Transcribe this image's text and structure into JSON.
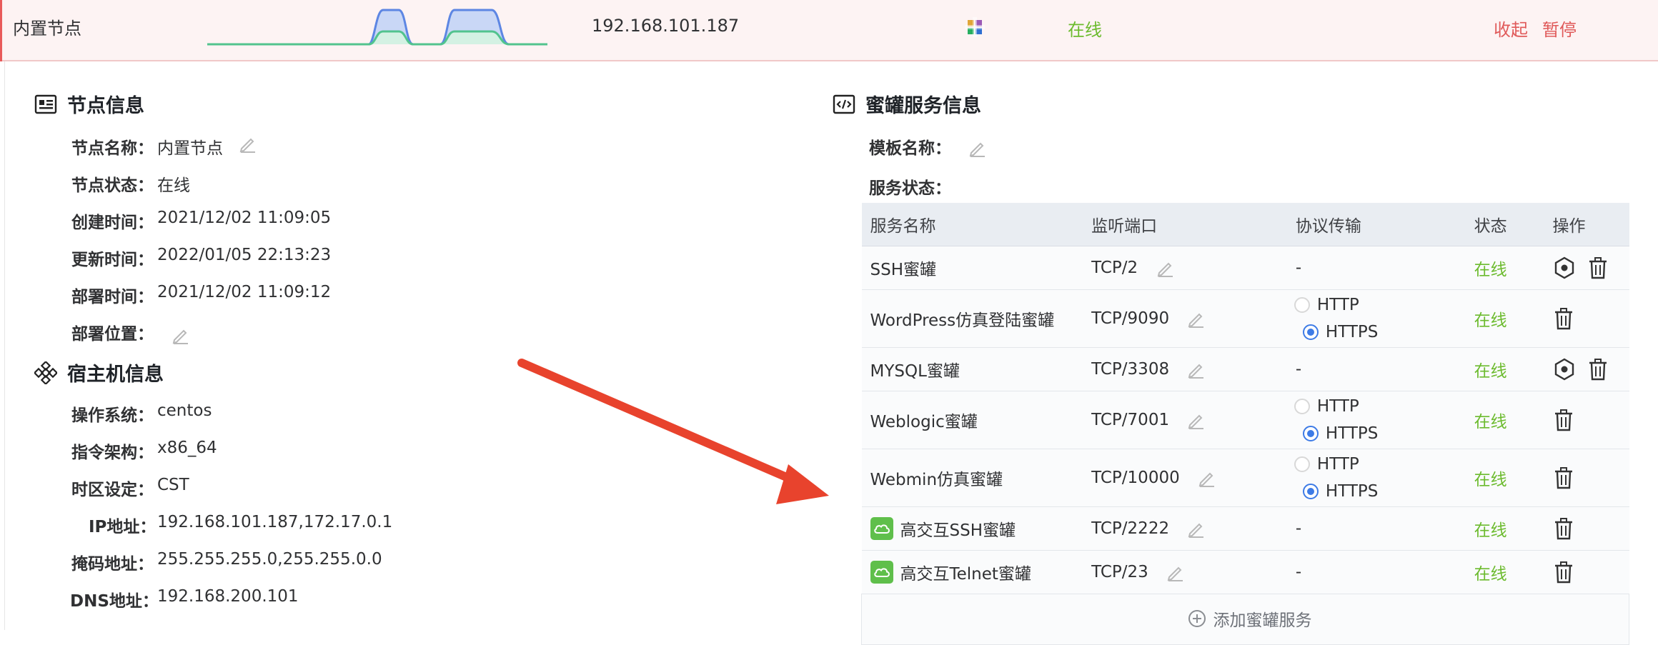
{
  "header": {
    "node_name": "内置节点",
    "ip": "192.168.101.187",
    "status": "在线",
    "collapse": "收起",
    "pause": "暂停"
  },
  "node_info": {
    "title": "节点信息",
    "rows": [
      {
        "label": "节点名称：",
        "value": "内置节点"
      },
      {
        "label": "节点状态：",
        "value": "在线"
      },
      {
        "label": "创建时间：",
        "value": "2021/12/02 11:09:05"
      },
      {
        "label": "更新时间：",
        "value": "2022/01/05 22:13:23"
      },
      {
        "label": "部署时间：",
        "value": "2021/12/02 11:09:12"
      },
      {
        "label": "部署位置：",
        "value": ""
      }
    ]
  },
  "host_info": {
    "title": "宿主机信息",
    "rows": [
      {
        "label": "操作系统：",
        "value": "centos"
      },
      {
        "label": "指令架构：",
        "value": "x86_64"
      },
      {
        "label": "时区设定：",
        "value": "CST"
      },
      {
        "label": "IP地址：",
        "value": "192.168.101.187,172.17.0.1"
      },
      {
        "label": "掩码地址：",
        "value": "255.255.255.0,255.255.0.0"
      },
      {
        "label": "DNS地址：",
        "value": "192.168.200.101"
      }
    ]
  },
  "honeypot_info": {
    "title": "蜜罐服务信息",
    "template_label": "模板名称：",
    "status_label": "服务状态：",
    "columns": [
      "服务名称",
      "监听端口",
      "协议传输",
      "状态",
      "操作"
    ],
    "services": [
      {
        "name": "SSH蜜罐",
        "port": "TCP/2",
        "proto": "-",
        "status": "在线"
      },
      {
        "name": "WordPress仿真登陆蜜罐",
        "port": "TCP/9090",
        "http": "HTTP",
        "https": "HTTPS",
        "status": "在线"
      },
      {
        "name": "MYSQL蜜罐",
        "port": "TCP/3308",
        "proto": "-",
        "status": "在线"
      },
      {
        "name": "Weblogic蜜罐",
        "port": "TCP/7001",
        "http": "HTTP",
        "https": "HTTPS",
        "status": "在线"
      },
      {
        "name": "Webmin仿真蜜罐",
        "port": "TCP/10000",
        "http": "HTTP",
        "https": "HTTPS",
        "status": "在线"
      },
      {
        "name": "高交互SSH蜜罐",
        "port": "TCP/2222",
        "proto": "-",
        "status": "在线"
      },
      {
        "name": "高交互Telnet蜜罐",
        "port": "TCP/23",
        "proto": "-",
        "status": "在线"
      }
    ],
    "add_label": "添加蜜罐服务"
  },
  "colors": {
    "online": "#6cbb2e",
    "danger": "#e05a5a",
    "radio": "#3d7be6",
    "arrow": "#e8432d"
  }
}
